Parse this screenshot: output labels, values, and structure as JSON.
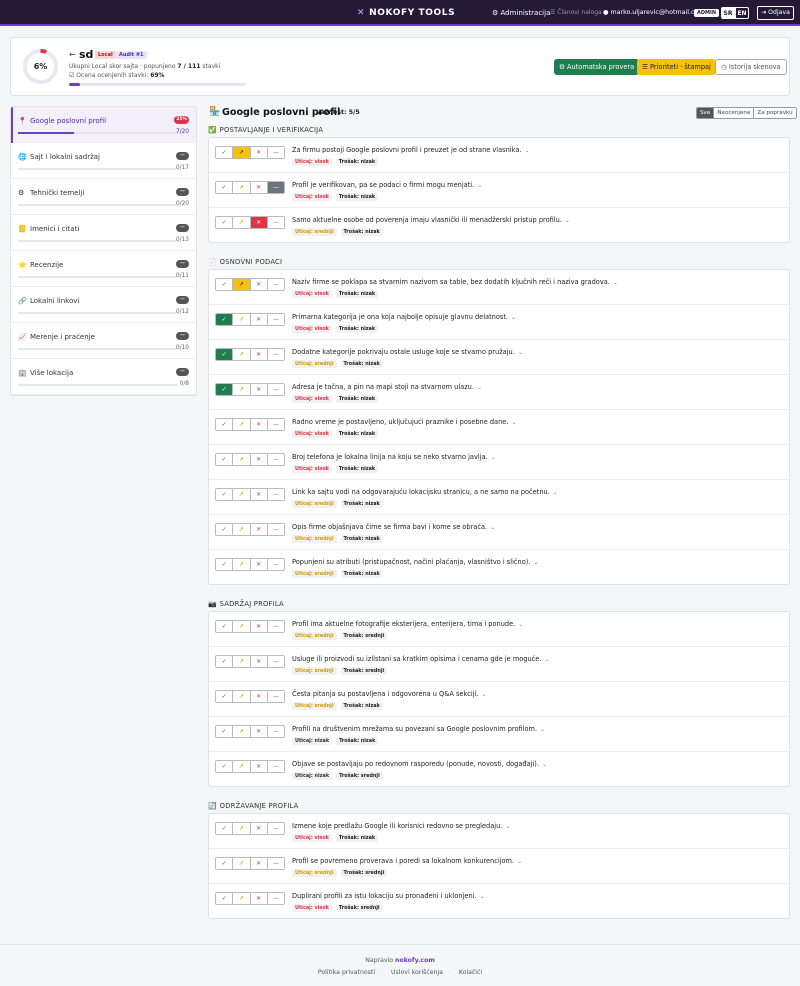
{
  "navbar": {
    "brand": "NOKOFY TOOLS",
    "brand_icon": "sparkle-x-icon",
    "admin_link": "Administracija",
    "members_link": "Članovi naloga",
    "email": "marko.uljarevic@hotmail.com",
    "role_badge": "ADMIN",
    "lang_sr": "SR",
    "lang_en": "EN",
    "logout": "Odjava"
  },
  "audit": {
    "percent": 6,
    "percent_label": "6%",
    "back_icon": "arrow-left-icon",
    "site_name": "sd",
    "type_badge": "Local",
    "audit_badge": "Audit #1",
    "summary_prefix": "Ukupni Local skor sajta · popunjeno ",
    "summary_count": "7 / 111",
    "summary_suffix": " stavki",
    "rated_prefix": "Ocena ocenjenih stavki: ",
    "rated_value": "69%",
    "btn_auto": "Automatska provera",
    "btn_priorities": "Prioriteti · štampaj",
    "btn_history": "Istorija skenova"
  },
  "sidebar": [
    {
      "icon": "📍",
      "label": "Google poslovni profil",
      "badge": "25%",
      "count": "7/20",
      "progress": 0.35,
      "active": true
    },
    {
      "icon": "🌐",
      "label": "Sajt i lokalni sadržaj",
      "badge": "—",
      "count": "0/17",
      "progress": 0,
      "active": false
    },
    {
      "icon": "⚙",
      "label": "Tehnički temelji",
      "badge": "—",
      "count": "0/20",
      "progress": 0,
      "active": false
    },
    {
      "icon": "📒",
      "label": "Imenici i citati",
      "badge": "—",
      "count": "0/13",
      "progress": 0,
      "active": false
    },
    {
      "icon": "⭐",
      "label": "Recenzije",
      "badge": "—",
      "count": "0/11",
      "progress": 0,
      "active": false
    },
    {
      "icon": "🔗",
      "label": "Lokalni linkovi",
      "badge": "—",
      "count": "0/12",
      "progress": 0,
      "active": false
    },
    {
      "icon": "📈",
      "label": "Merenje i praćenje",
      "badge": "—",
      "count": "0/10",
      "progress": 0,
      "active": false
    },
    {
      "icon": "🏢",
      "label": "Više lokacija",
      "badge": "—",
      "count": "0/8",
      "progress": 0,
      "active": false
    }
  ],
  "main": {
    "title_icon": "🏪",
    "title": "Google poslovni profil",
    "importance": "Važnost: 5/5",
    "filters": [
      "Sve",
      "Neocenjene",
      "Za popravku"
    ],
    "active_filter": 0
  },
  "answer_options": [
    {
      "key": "ok",
      "glyph": "✓",
      "label": "check-icon"
    },
    {
      "key": "part",
      "glyph": "↗",
      "label": "partial-icon"
    },
    {
      "key": "fail",
      "glyph": "✕",
      "label": "cross-icon"
    },
    {
      "key": "na",
      "glyph": "—",
      "label": "na-icon"
    }
  ],
  "sections": [
    {
      "icon": "✅",
      "title": "POSTAVLJANJE I VERIFIKACIJA",
      "items": [
        {
          "text": "Za firmu postoji Google poslovni profil i preuzet je od strane vlasnika.",
          "impact": "Uticaj: visok",
          "impact_level": "high",
          "cost": "Trošak: nizak",
          "answer": "part"
        },
        {
          "text": "Profil je verifikovan, pa se podaci o firmi mogu menjati.",
          "impact": "Uticaj: visok",
          "impact_level": "high",
          "cost": "Trošak: nizak",
          "answer": "na"
        },
        {
          "text": "Samo aktuelne osobe od poverenja imaju vlasnički ili menadžerski pristup profilu.",
          "impact": "Uticaj: srednji",
          "impact_level": "mid",
          "cost": "Trošak: nizak",
          "answer": "fail"
        }
      ]
    },
    {
      "icon": "📄",
      "title": "OSNOVNI PODACI",
      "items": [
        {
          "text": "Naziv firme se poklapa sa stvarnim nazivom sa table, bez dodatih ključnih reči i naziva gradova.",
          "impact": "Uticaj: visok",
          "impact_level": "high",
          "cost": "Trošak: nizak",
          "answer": "part"
        },
        {
          "text": "Primarna kategorija je ona koja najbolje opisuje glavnu delatnost.",
          "impact": "Uticaj: visok",
          "impact_level": "high",
          "cost": "Trošak: nizak",
          "answer": "ok"
        },
        {
          "text": "Dodatne kategorije pokrivaju ostale usluge koje se stvarno pružaju.",
          "impact": "Uticaj: srednji",
          "impact_level": "mid",
          "cost": "Trošak: nizak",
          "answer": "ok"
        },
        {
          "text": "Adresa je tačna, a pin na mapi stoji na stvarnom ulazu.",
          "impact": "Uticaj: visok",
          "impact_level": "high",
          "cost": "Trošak: nizak",
          "answer": "ok"
        },
        {
          "text": "Radno vreme je postavljeno, uključujući praznike i posebne dane.",
          "impact": "Uticaj: visok",
          "impact_level": "high",
          "cost": "Trošak: nizak",
          "answer": null
        },
        {
          "text": "Broj telefona je lokalna linija na koju se neko stvarno javlja.",
          "impact": "Uticaj: visok",
          "impact_level": "high",
          "cost": "Trošak: nizak",
          "answer": null
        },
        {
          "text": "Link ka sajtu vodi na odgovarajuću lokacijsku stranicu, a ne samo na početnu.",
          "impact": "Uticaj: srednji",
          "impact_level": "mid",
          "cost": "Trošak: nizak",
          "answer": null
        },
        {
          "text": "Opis firme objašnjava čime se firma bavi i kome se obraća.",
          "impact": "Uticaj: srednji",
          "impact_level": "mid",
          "cost": "Trošak: nizak",
          "answer": null
        },
        {
          "text": "Popunjeni su atributi (pristupačnost, načini plaćanja, vlasništvo i slično).",
          "impact": "Uticaj: srednji",
          "impact_level": "mid",
          "cost": "Trošak: nizak",
          "answer": null
        }
      ]
    },
    {
      "icon": "📷",
      "title": "SADRŽAJ PROFILA",
      "items": [
        {
          "text": "Profil ima aktuelne fotografije eksterijera, enterijera, tima i ponude.",
          "impact": "Uticaj: srednji",
          "impact_level": "mid",
          "cost": "Trošak: srednji",
          "answer": null
        },
        {
          "text": "Usluge ili proizvodi su izlistani sa kratkim opisima i cenama gde je moguće.",
          "impact": "Uticaj: srednji",
          "impact_level": "mid",
          "cost": "Trošak: srednji",
          "answer": null
        },
        {
          "text": "Česta pitanja su postavljena i odgovorena u Q&A sekciji.",
          "impact": "Uticaj: srednji",
          "impact_level": "mid",
          "cost": "Trošak: nizak",
          "answer": null
        },
        {
          "text": "Profili na društvenim mrežama su povezani sa Google poslovnim profilom.",
          "impact": "Uticaj: nizak",
          "impact_level": "low",
          "cost": "Trošak: nizak",
          "answer": null
        },
        {
          "text": "Objave se postavljaju po redovnom rasporedu (ponude, novosti, događaji).",
          "impact": "Uticaj: nizak",
          "impact_level": "low",
          "cost": "Trošak: srednji",
          "answer": null
        }
      ]
    },
    {
      "icon": "🔄",
      "title": "ODRŽAVANJE PROFILA",
      "items": [
        {
          "text": "Izmene koje predlažu Google ili korisnici redovno se pregledaju.",
          "impact": "Uticaj: visok",
          "impact_level": "high",
          "cost": "Trošak: nizak",
          "answer": null
        },
        {
          "text": "Profil se povremeno proverava i poredi sa lokalnom konkurencijom.",
          "impact": "Uticaj: srednji",
          "impact_level": "mid",
          "cost": "Trošak: srednji",
          "answer": null
        },
        {
          "text": "Duplirani profili za istu lokaciju su pronađeni i uklonjeni.",
          "impact": "Uticaj: visok",
          "impact_level": "high",
          "cost": "Trošak: srednji",
          "answer": null
        }
      ]
    }
  ],
  "footer": {
    "made_by_prefix": "Napravio ",
    "made_by_brand": "nokofy.com",
    "links": [
      "Politika privatnosti",
      "Uslovi korišćenja",
      "Kolačići"
    ]
  },
  "colors": {
    "accent": "#6b3fc4",
    "navbar": "#241a38",
    "ok": "#1e7e4d",
    "partial": "#f4c20d",
    "fail": "#dc3545",
    "na": "#6c757d"
  }
}
